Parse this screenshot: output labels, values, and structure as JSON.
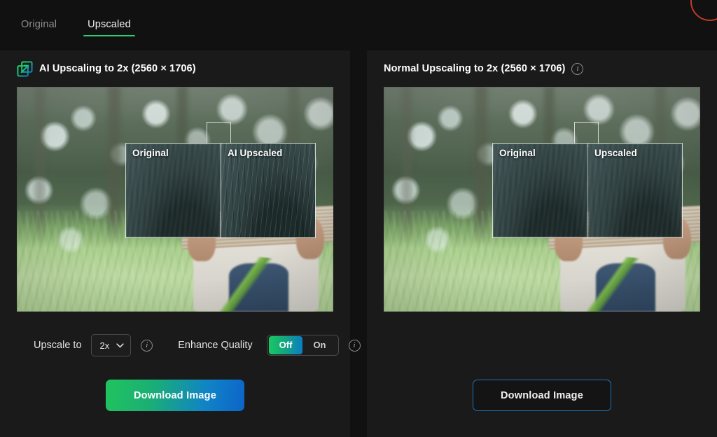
{
  "tabs": [
    {
      "label": "Original",
      "active": false
    },
    {
      "label": "Upscaled",
      "active": true
    }
  ],
  "panels": {
    "left": {
      "icon": "ai-upscale-icon",
      "title": "AI Upscaling to 2x (2560 × 1706)",
      "compare": {
        "left_label": "Original",
        "right_label": "AI Upscaled"
      },
      "controls": {
        "upscale_label": "Upscale to",
        "upscale_value": "2x",
        "upscale_options": [
          "2x"
        ],
        "upscale_info_icon": "info-icon",
        "enhance_label": "Enhance Quality",
        "enhance_off": "Off",
        "enhance_on": "On",
        "enhance_selected": "Off",
        "enhance_info_icon": "info-icon"
      },
      "download_label": "Download Image"
    },
    "right": {
      "title": "Normal Upscaling to 2x (2560 × 1706)",
      "info_icon": "info-icon",
      "compare": {
        "left_label": "Original",
        "right_label": "Upscaled"
      },
      "download_label": "Download Image"
    }
  },
  "colors": {
    "page_background": "#111111",
    "panel_background": "#1a1a1a",
    "accent_green": "#2ecc71",
    "gradient_start": "#17c964",
    "gradient_end": "#0a7ec4",
    "outline_blue": "#1f73b8",
    "corner_red": "#c0392b"
  }
}
